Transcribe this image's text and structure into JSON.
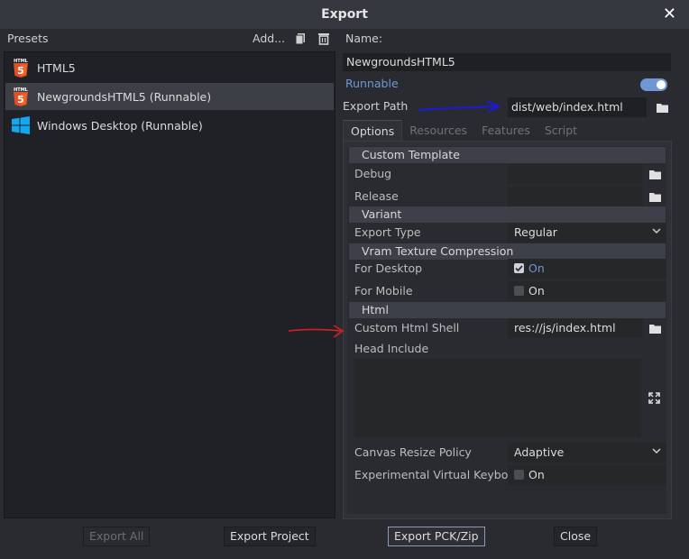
{
  "window": {
    "title": "Export",
    "close_glyph": "✕"
  },
  "presets": {
    "label": "Presets",
    "add_label": "Add...",
    "items": [
      {
        "label": "HTML5",
        "icon": "html5-icon"
      },
      {
        "label": "NewgroundsHTML5 (Runnable)",
        "icon": "html5-icon",
        "selected": true
      },
      {
        "label": "Windows Desktop (Runnable)",
        "icon": "windows-icon"
      }
    ]
  },
  "details": {
    "name_label": "Name:",
    "name_value": "NewgroundsHTML5",
    "runnable_label": "Runnable",
    "runnable_on": true,
    "export_path_label": "Export Path",
    "export_path_value": "dist/web/index.html"
  },
  "tabs": [
    "Options",
    "Resources",
    "Features",
    "Script"
  ],
  "options": {
    "custom_template": "Custom Template",
    "debug_label": "Debug",
    "release_label": "Release",
    "variant": "Variant",
    "export_type_label": "Export Type",
    "export_type_value": "Regular",
    "vram": "Vram Texture Compression",
    "for_desktop_label": "For Desktop",
    "for_desktop_value": "On",
    "for_mobile_label": "For Mobile",
    "for_mobile_value": "On",
    "html": "Html",
    "custom_shell_label": "Custom Html Shell",
    "custom_shell_value": "res://js/index.html",
    "head_include_label": "Head Include",
    "canvas_resize_label": "Canvas Resize Policy",
    "canvas_resize_value": "Adaptive",
    "virtual_keyboard_label": "Experimental Virtual Keyboar",
    "virtual_keyboard_value": "On"
  },
  "buttons": {
    "export_all": "Export All",
    "export_project": "Export Project",
    "export_pck": "Export PCK/Zip",
    "close": "Close"
  },
  "colors": {
    "accent": "#6f97d6",
    "annotation_blue": "#1a1ad8",
    "annotation_red": "#d42020"
  }
}
